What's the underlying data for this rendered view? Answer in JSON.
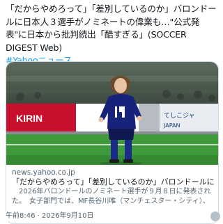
{
  "post": {
    "text": "「だからやめろって」「差別しているのか」バロンドールに日本人３選手がノミネートの偉業も…\"公式発表\"に日本から批判続出「酷すぎる」(SOCCER DIGEST Web)",
    "hashtag": "#Yahooニュース"
  },
  "card": {
    "image_alt": "Female soccer player in blue Japan national team uniform number 14",
    "domain": "news.yahoo.co.jp",
    "headline": "「だからやめろって」「差別しているのか」バロンドールに日本人３...",
    "description": "　2026年バロンドールのノミネート選手が９月８日に発表された。　女子部門では、MF長谷川唯（マンチェスター・シティ）、MF松窪真心..."
  },
  "timestamp": "午前8:46 · 2026年9月10日"
}
